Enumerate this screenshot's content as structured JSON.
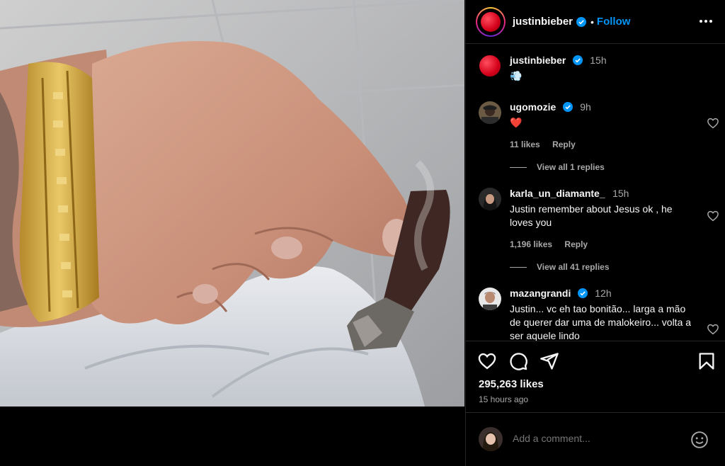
{
  "post": {
    "username": "justinbieber",
    "follow_label": "Follow",
    "separator": "•"
  },
  "caption": {
    "username": "justinbieber",
    "time": "15h",
    "text": "💨"
  },
  "comments": [
    {
      "username": "ugomozie",
      "time": "9h",
      "text": "❤️",
      "likes": "11 likes",
      "reply": "Reply",
      "view_replies": "View all 1 replies"
    },
    {
      "username": "karla_un_diamante_",
      "time": "15h",
      "text": "Justin remember about Jesus ok , he loves you",
      "likes": "1,196 likes",
      "reply": "Reply",
      "view_replies": "View all 41 replies"
    },
    {
      "username": "mazangrandi",
      "time": "12h",
      "text": "Justin... vc eh tao bonitão... larga a mão de querer dar uma de malokeiro... volta a ser aquele lindo"
    }
  ],
  "stats": {
    "likes": "295,263 likes",
    "posted": "15 hours ago"
  },
  "composer": {
    "placeholder": "Add a comment..."
  },
  "icons": {
    "more": "more-options-icon",
    "verified": "verified-badge-icon",
    "heart": "heart-icon",
    "comment": "comment-icon",
    "share": "share-icon",
    "save": "bookmark-icon",
    "emoji": "emoji-icon"
  },
  "colors": {
    "accent": "#0095f6",
    "verified": "#0095f6",
    "background": "#000000",
    "muted": "#a8a8a8"
  }
}
